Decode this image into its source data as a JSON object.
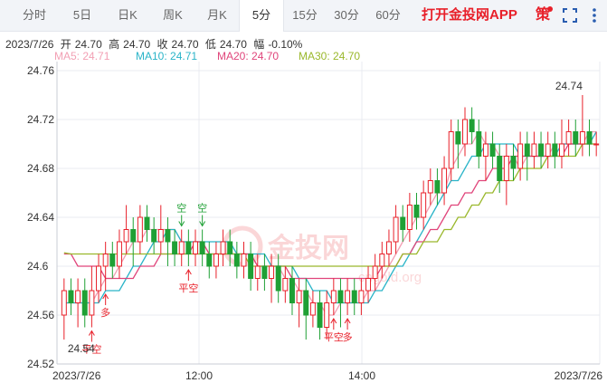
{
  "tabs": [
    {
      "label": "分时",
      "active": false
    },
    {
      "label": "5日",
      "active": false
    },
    {
      "label": "日K",
      "active": false
    },
    {
      "label": "周K",
      "active": false
    },
    {
      "label": "月K",
      "active": false
    },
    {
      "label": "5分",
      "active": true
    },
    {
      "label": "15分",
      "active": false
    },
    {
      "label": "30分",
      "active": false
    },
    {
      "label": "60分",
      "active": false
    }
  ],
  "brand": "打开金投网APP",
  "strategy_label": "策",
  "info": {
    "date": "2023/7/26",
    "open_label": "开",
    "open": "24.70",
    "high_label": "高",
    "high": "24.70",
    "close_label": "收",
    "close": "24.70",
    "low_label": "低",
    "low": "24.70",
    "change_label": "幅",
    "change": "-0.10%"
  },
  "ma": [
    {
      "label": "MA5: 24.71",
      "color": "#f2a0b4"
    },
    {
      "label": "MA10: 24.71",
      "color": "#2ab4c8"
    },
    {
      "label": "MA20: 24.70",
      "color": "#e0457b"
    },
    {
      "label": "MA30: 24.70",
      "color": "#9ab82c"
    }
  ],
  "colors": {
    "up": "#e8202a",
    "down": "#1fa035",
    "grid": "#e8ebf0",
    "axis": "#c8ccd4"
  },
  "watermark": "金投网",
  "watermark_sub": "cngold.org",
  "chart_data": {
    "type": "candlestick",
    "ylim": [
      24.52,
      24.76
    ],
    "y_ticks": [
      "24.52",
      "24.56",
      "24.6",
      "24.64",
      "24.68",
      "24.72",
      "24.76"
    ],
    "x_labels": [
      "2023/7/26",
      "12:00",
      "14:00",
      "2023/7/26"
    ],
    "max_label": "24.74",
    "min_label": "24.54",
    "candles": [
      [
        24.56,
        24.58,
        24.59,
        24.54
      ],
      [
        24.58,
        24.57,
        24.59,
        24.56
      ],
      [
        24.57,
        24.58,
        24.59,
        24.55
      ],
      [
        24.58,
        24.56,
        24.59,
        24.55
      ],
      [
        24.56,
        24.58,
        24.6,
        24.55
      ],
      [
        24.58,
        24.6,
        24.61,
        24.57
      ],
      [
        24.6,
        24.61,
        24.62,
        24.58
      ],
      [
        24.61,
        24.6,
        24.62,
        24.59
      ],
      [
        24.6,
        24.62,
        24.63,
        24.59
      ],
      [
        24.62,
        24.63,
        24.65,
        24.61
      ],
      [
        24.63,
        24.62,
        24.64,
        24.6
      ],
      [
        24.62,
        24.64,
        24.65,
        24.61
      ],
      [
        24.64,
        24.63,
        24.65,
        24.62
      ],
      [
        24.63,
        24.62,
        24.64,
        24.61
      ],
      [
        24.62,
        24.63,
        24.65,
        24.61
      ],
      [
        24.63,
        24.62,
        24.64,
        24.6
      ],
      [
        24.62,
        24.61,
        24.63,
        24.6
      ],
      [
        24.61,
        24.62,
        24.63,
        24.6
      ],
      [
        24.62,
        24.61,
        24.63,
        24.6
      ],
      [
        24.61,
        24.62,
        24.63,
        24.6
      ],
      [
        24.62,
        24.61,
        24.63,
        24.6
      ],
      [
        24.61,
        24.6,
        24.62,
        24.59
      ],
      [
        24.6,
        24.61,
        24.62,
        24.59
      ],
      [
        24.61,
        24.62,
        24.63,
        24.6
      ],
      [
        24.62,
        24.61,
        24.63,
        24.6
      ],
      [
        24.61,
        24.6,
        24.62,
        24.59
      ],
      [
        24.6,
        24.61,
        24.62,
        24.59
      ],
      [
        24.61,
        24.59,
        24.62,
        24.58
      ],
      [
        24.59,
        24.6,
        24.61,
        24.58
      ],
      [
        24.6,
        24.59,
        24.61,
        24.58
      ],
      [
        24.59,
        24.6,
        24.61,
        24.57
      ],
      [
        24.6,
        24.58,
        24.61,
        24.57
      ],
      [
        24.58,
        24.59,
        24.6,
        24.57
      ],
      [
        24.59,
        24.57,
        24.6,
        24.56
      ],
      [
        24.57,
        24.58,
        24.59,
        24.55
      ],
      [
        24.58,
        24.56,
        24.59,
        24.54
      ],
      [
        24.56,
        24.57,
        24.58,
        24.55
      ],
      [
        24.57,
        24.55,
        24.58,
        24.54
      ],
      [
        24.55,
        24.57,
        24.58,
        24.54
      ],
      [
        24.57,
        24.58,
        24.59,
        24.56
      ],
      [
        24.58,
        24.57,
        24.59,
        24.55
      ],
      [
        24.57,
        24.58,
        24.59,
        24.56
      ],
      [
        24.58,
        24.57,
        24.59,
        24.56
      ],
      [
        24.57,
        24.58,
        24.59,
        24.56
      ],
      [
        24.58,
        24.59,
        24.6,
        24.57
      ],
      [
        24.59,
        24.6,
        24.61,
        24.58
      ],
      [
        24.6,
        24.61,
        24.62,
        24.59
      ],
      [
        24.61,
        24.62,
        24.63,
        24.6
      ],
      [
        24.62,
        24.64,
        24.65,
        24.61
      ],
      [
        24.64,
        24.63,
        24.65,
        24.62
      ],
      [
        24.63,
        24.65,
        24.66,
        24.62
      ],
      [
        24.65,
        24.64,
        24.66,
        24.63
      ],
      [
        24.64,
        24.66,
        24.67,
        24.63
      ],
      [
        24.66,
        24.67,
        24.68,
        24.65
      ],
      [
        24.67,
        24.66,
        24.68,
        24.65
      ],
      [
        24.66,
        24.68,
        24.69,
        24.65
      ],
      [
        24.68,
        24.71,
        24.72,
        24.67
      ],
      [
        24.71,
        24.7,
        24.72,
        24.68
      ],
      [
        24.7,
        24.72,
        24.73,
        24.69
      ],
      [
        24.72,
        24.71,
        24.73,
        24.7
      ],
      [
        24.71,
        24.69,
        24.72,
        24.68
      ],
      [
        24.69,
        24.7,
        24.71,
        24.67
      ],
      [
        24.7,
        24.69,
        24.71,
        24.68
      ],
      [
        24.69,
        24.67,
        24.7,
        24.66
      ],
      [
        24.67,
        24.69,
        24.7,
        24.65
      ],
      [
        24.69,
        24.68,
        24.7,
        24.67
      ],
      [
        24.68,
        24.7,
        24.71,
        24.67
      ],
      [
        24.7,
        24.69,
        24.71,
        24.67
      ],
      [
        24.69,
        24.7,
        24.71,
        24.68
      ],
      [
        24.7,
        24.69,
        24.71,
        24.68
      ],
      [
        24.69,
        24.7,
        24.71,
        24.68
      ],
      [
        24.7,
        24.69,
        24.71,
        24.68
      ],
      [
        24.69,
        24.7,
        24.72,
        24.68
      ],
      [
        24.7,
        24.71,
        24.72,
        24.69
      ],
      [
        24.71,
        24.7,
        24.72,
        24.69
      ],
      [
        24.7,
        24.71,
        24.74,
        24.69
      ],
      [
        24.71,
        24.7,
        24.72,
        24.69
      ],
      [
        24.7,
        24.7,
        24.71,
        24.69
      ]
    ],
    "series": [
      {
        "name": "MA5",
        "color": "#f2a0b4",
        "values": [
          24.57,
          24.57,
          24.57,
          24.57,
          24.57,
          24.58,
          24.59,
          24.59,
          24.6,
          24.61,
          24.62,
          24.62,
          24.63,
          24.63,
          24.63,
          24.63,
          24.63,
          24.62,
          24.62,
          24.62,
          24.62,
          24.61,
          24.61,
          24.61,
          24.61,
          24.61,
          24.61,
          24.61,
          24.6,
          24.6,
          24.6,
          24.6,
          24.59,
          24.59,
          24.58,
          24.58,
          24.57,
          24.57,
          24.56,
          24.56,
          24.57,
          24.57,
          24.57,
          24.57,
          24.58,
          24.58,
          24.59,
          24.6,
          24.61,
          24.62,
          24.63,
          24.64,
          24.64,
          24.65,
          24.66,
          24.66,
          24.68,
          24.69,
          24.7,
          24.7,
          24.71,
          24.7,
          24.7,
          24.69,
          24.69,
          24.69,
          24.68,
          24.69,
          24.69,
          24.69,
          24.69,
          24.7,
          24.7,
          24.7,
          24.7,
          24.7,
          24.71,
          24.71
        ]
      },
      {
        "name": "MA10",
        "color": "#2ab4c8",
        "values": [
          24.57,
          24.57,
          24.57,
          24.57,
          24.57,
          24.57,
          24.58,
          24.58,
          24.58,
          24.59,
          24.6,
          24.6,
          24.61,
          24.62,
          24.62,
          24.63,
          24.63,
          24.62,
          24.62,
          24.62,
          24.62,
          24.62,
          24.62,
          24.62,
          24.62,
          24.61,
          24.61,
          24.61,
          24.61,
          24.61,
          24.6,
          24.6,
          24.6,
          24.6,
          24.59,
          24.59,
          24.58,
          24.58,
          24.58,
          24.57,
          24.57,
          24.57,
          24.57,
          24.57,
          24.57,
          24.58,
          24.58,
          24.59,
          24.6,
          24.6,
          24.61,
          24.62,
          24.63,
          24.64,
          24.65,
          24.66,
          24.67,
          24.67,
          24.68,
          24.69,
          24.69,
          24.7,
          24.7,
          24.7,
          24.7,
          24.7,
          24.69,
          24.69,
          24.69,
          24.69,
          24.69,
          24.69,
          24.7,
          24.7,
          24.7,
          24.7,
          24.7,
          24.71
        ]
      },
      {
        "name": "MA20",
        "color": "#e0457b",
        "values": [
          24.61,
          24.61,
          24.6,
          24.6,
          24.6,
          24.6,
          24.59,
          24.59,
          24.59,
          24.59,
          24.59,
          24.6,
          24.6,
          24.6,
          24.61,
          24.61,
          24.61,
          24.61,
          24.61,
          24.62,
          24.62,
          24.61,
          24.61,
          24.61,
          24.61,
          24.61,
          24.61,
          24.61,
          24.6,
          24.6,
          24.6,
          24.6,
          24.6,
          24.59,
          24.59,
          24.59,
          24.59,
          24.59,
          24.59,
          24.59,
          24.59,
          24.59,
          24.59,
          24.59,
          24.59,
          24.59,
          24.6,
          24.6,
          24.6,
          24.61,
          24.61,
          24.62,
          24.62,
          24.63,
          24.63,
          24.64,
          24.65,
          24.65,
          24.66,
          24.66,
          24.67,
          24.67,
          24.68,
          24.68,
          24.68,
          24.69,
          24.69,
          24.69,
          24.69,
          24.69,
          24.69,
          24.69,
          24.69,
          24.7,
          24.7,
          24.7,
          24.7,
          24.7
        ]
      },
      {
        "name": "MA30",
        "color": "#9ab82c",
        "values": [
          24.611,
          24.61,
          24.61,
          24.61,
          24.61,
          24.61,
          24.61,
          24.61,
          24.61,
          24.61,
          24.61,
          24.61,
          24.61,
          24.61,
          24.61,
          24.61,
          24.61,
          24.61,
          24.61,
          24.61,
          24.61,
          24.61,
          24.61,
          24.61,
          24.61,
          24.61,
          24.61,
          24.6,
          24.6,
          24.6,
          24.6,
          24.6,
          24.6,
          24.6,
          24.6,
          24.6,
          24.6,
          24.6,
          24.6,
          24.6,
          24.6,
          24.6,
          24.6,
          24.6,
          24.6,
          24.6,
          24.6,
          24.6,
          24.6,
          24.61,
          24.61,
          24.61,
          24.62,
          24.62,
          24.62,
          24.63,
          24.63,
          24.64,
          24.64,
          24.65,
          24.65,
          24.66,
          24.66,
          24.67,
          24.67,
          24.67,
          24.68,
          24.68,
          24.68,
          24.68,
          24.69,
          24.69,
          24.69,
          24.69,
          24.69,
          24.7,
          24.7,
          24.7
        ]
      }
    ],
    "markers": [
      {
        "index": 4,
        "label": "平空",
        "direction": "up",
        "color": "#e8202a"
      },
      {
        "index": 6,
        "label": "多",
        "direction": "up",
        "color": "#e8202a"
      },
      {
        "index": 17,
        "label": "空",
        "direction": "down",
        "color": "#1fa035"
      },
      {
        "index": 20,
        "label": "空",
        "direction": "down",
        "color": "#1fa035"
      },
      {
        "index": 18,
        "label": "平空",
        "direction": "up",
        "color": "#e8202a"
      },
      {
        "index": 39,
        "label": "平空",
        "direction": "up",
        "color": "#e8202a"
      },
      {
        "index": 41,
        "label": "多",
        "direction": "up",
        "color": "#e8202a"
      }
    ]
  }
}
